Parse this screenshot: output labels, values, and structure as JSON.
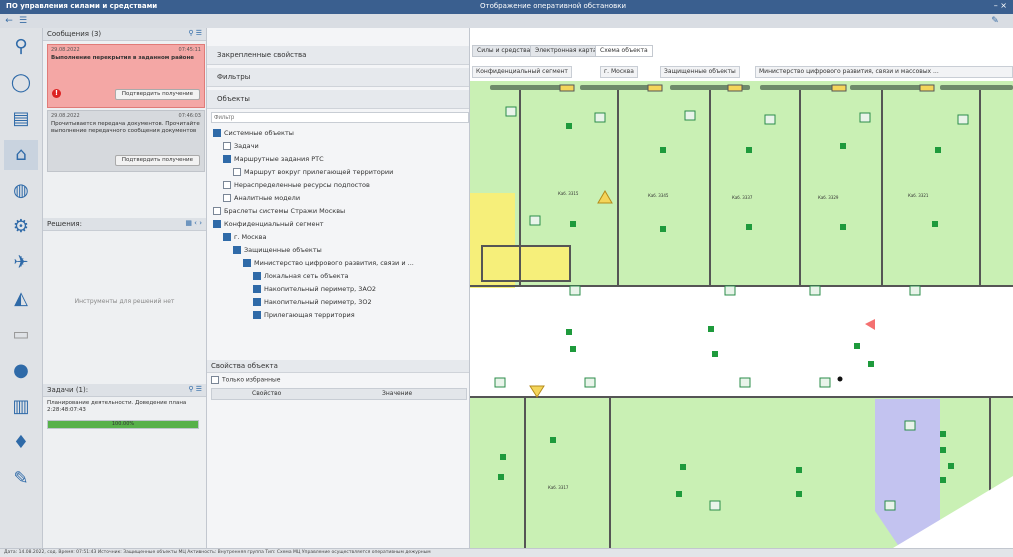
{
  "app": {
    "title": "ПО управления силами и средствами",
    "window_controls": "– ×"
  },
  "center_title": "Отображение оперативной обстановки",
  "left_rail": {
    "icons": [
      "bike-icon",
      "circle-icon",
      "bus-icon",
      "cap-icon",
      "globe-icon",
      "flow-icon",
      "satellite-icon",
      "radar-icon",
      "document-icon",
      "info-icon",
      "chart-icon",
      "bulb-icon",
      "pen-icon"
    ]
  },
  "messages_panel": {
    "title": "Сообщения (3)",
    "items": [
      {
        "date": "29.08.2022",
        "time": "07:45:11",
        "text": "Выполнение перекрытия в заданном районе",
        "button": "Подтвердить получение",
        "alert": true
      },
      {
        "date": "29.08.2022",
        "time": "07:46:03",
        "text": "Прочитывается передача документов. Прочитайте выполнение передачного сообщения документов",
        "button": "Подтвердить получение",
        "alert": false
      }
    ]
  },
  "decisions_panel": {
    "title": "Решения:",
    "empty_text": "Инструменты для решений нет"
  },
  "tasks_panel": {
    "title": "Задачи (1):",
    "task_text": "Планирование деятельности. Доведение плана 2:28:48:07:43",
    "progress_label": "100.00%",
    "progress": 1.0
  },
  "objects_column": {
    "sections": [
      "Закрепленные свойства",
      "Фильтры",
      "Объекты"
    ],
    "filter_placeholder": "Фильтр",
    "tree": [
      {
        "label": "Системные объекты",
        "checked": true,
        "indent": 0
      },
      {
        "label": "Задачи",
        "checked": false,
        "indent": 1
      },
      {
        "label": "Маршрутные задания РТС",
        "checked": true,
        "indent": 1
      },
      {
        "label": "Маршрут вокруг прилегающей территории",
        "checked": false,
        "indent": 2
      },
      {
        "label": "Нераспределенные ресурсы подпостов",
        "checked": false,
        "indent": 1
      },
      {
        "label": "Аналитные модели",
        "checked": false,
        "indent": 1
      },
      {
        "label": "Браслеты системы Стражи Москвы",
        "checked": false,
        "indent": 0
      },
      {
        "label": "Конфиденциальный сегмент",
        "checked": true,
        "indent": 0
      },
      {
        "label": "г. Москва",
        "checked": true,
        "indent": 1
      },
      {
        "label": "Защищенные объекты",
        "checked": true,
        "indent": 2
      },
      {
        "label": "Министерство цифрового развития, связи и ...",
        "checked": true,
        "indent": 3
      },
      {
        "label": "Локальная сеть объекта",
        "checked": true,
        "indent": 4
      },
      {
        "label": "Накопительный периметр, 3АО2",
        "checked": true,
        "indent": 4
      },
      {
        "label": "Накопительный периметр, 3О2",
        "checked": true,
        "indent": 4
      },
      {
        "label": "Прилегающая территория",
        "checked": true,
        "indent": 4
      }
    ],
    "properties_title": "Свойства объекта",
    "only_selected": "Только избранные",
    "prop_headers": [
      "Свойство",
      "Значение"
    ]
  },
  "tabs": [
    "Силы и средства",
    "Электронная карта",
    "Схема объекта"
  ],
  "breadcrumb": [
    "Конфиденциальный сегмент",
    "г. Москва",
    "Защищенные объекты",
    "Министерство цифрового развития, связи и массовых ..."
  ],
  "rooms": [
    "Каб. 3315",
    "Каб. 3345",
    "Каб. 3337",
    "Каб. 3329",
    "Каб. 3321",
    "Каб. 3317"
  ],
  "status_text": "Дата: 14.08.2022, сод. Время: 07:51:43   Источник: Защищенные объекты МЦ   Активность: Внутренняя группа   Тип: Схема МЦ   Управление осуществляется оперативным дежурным"
}
